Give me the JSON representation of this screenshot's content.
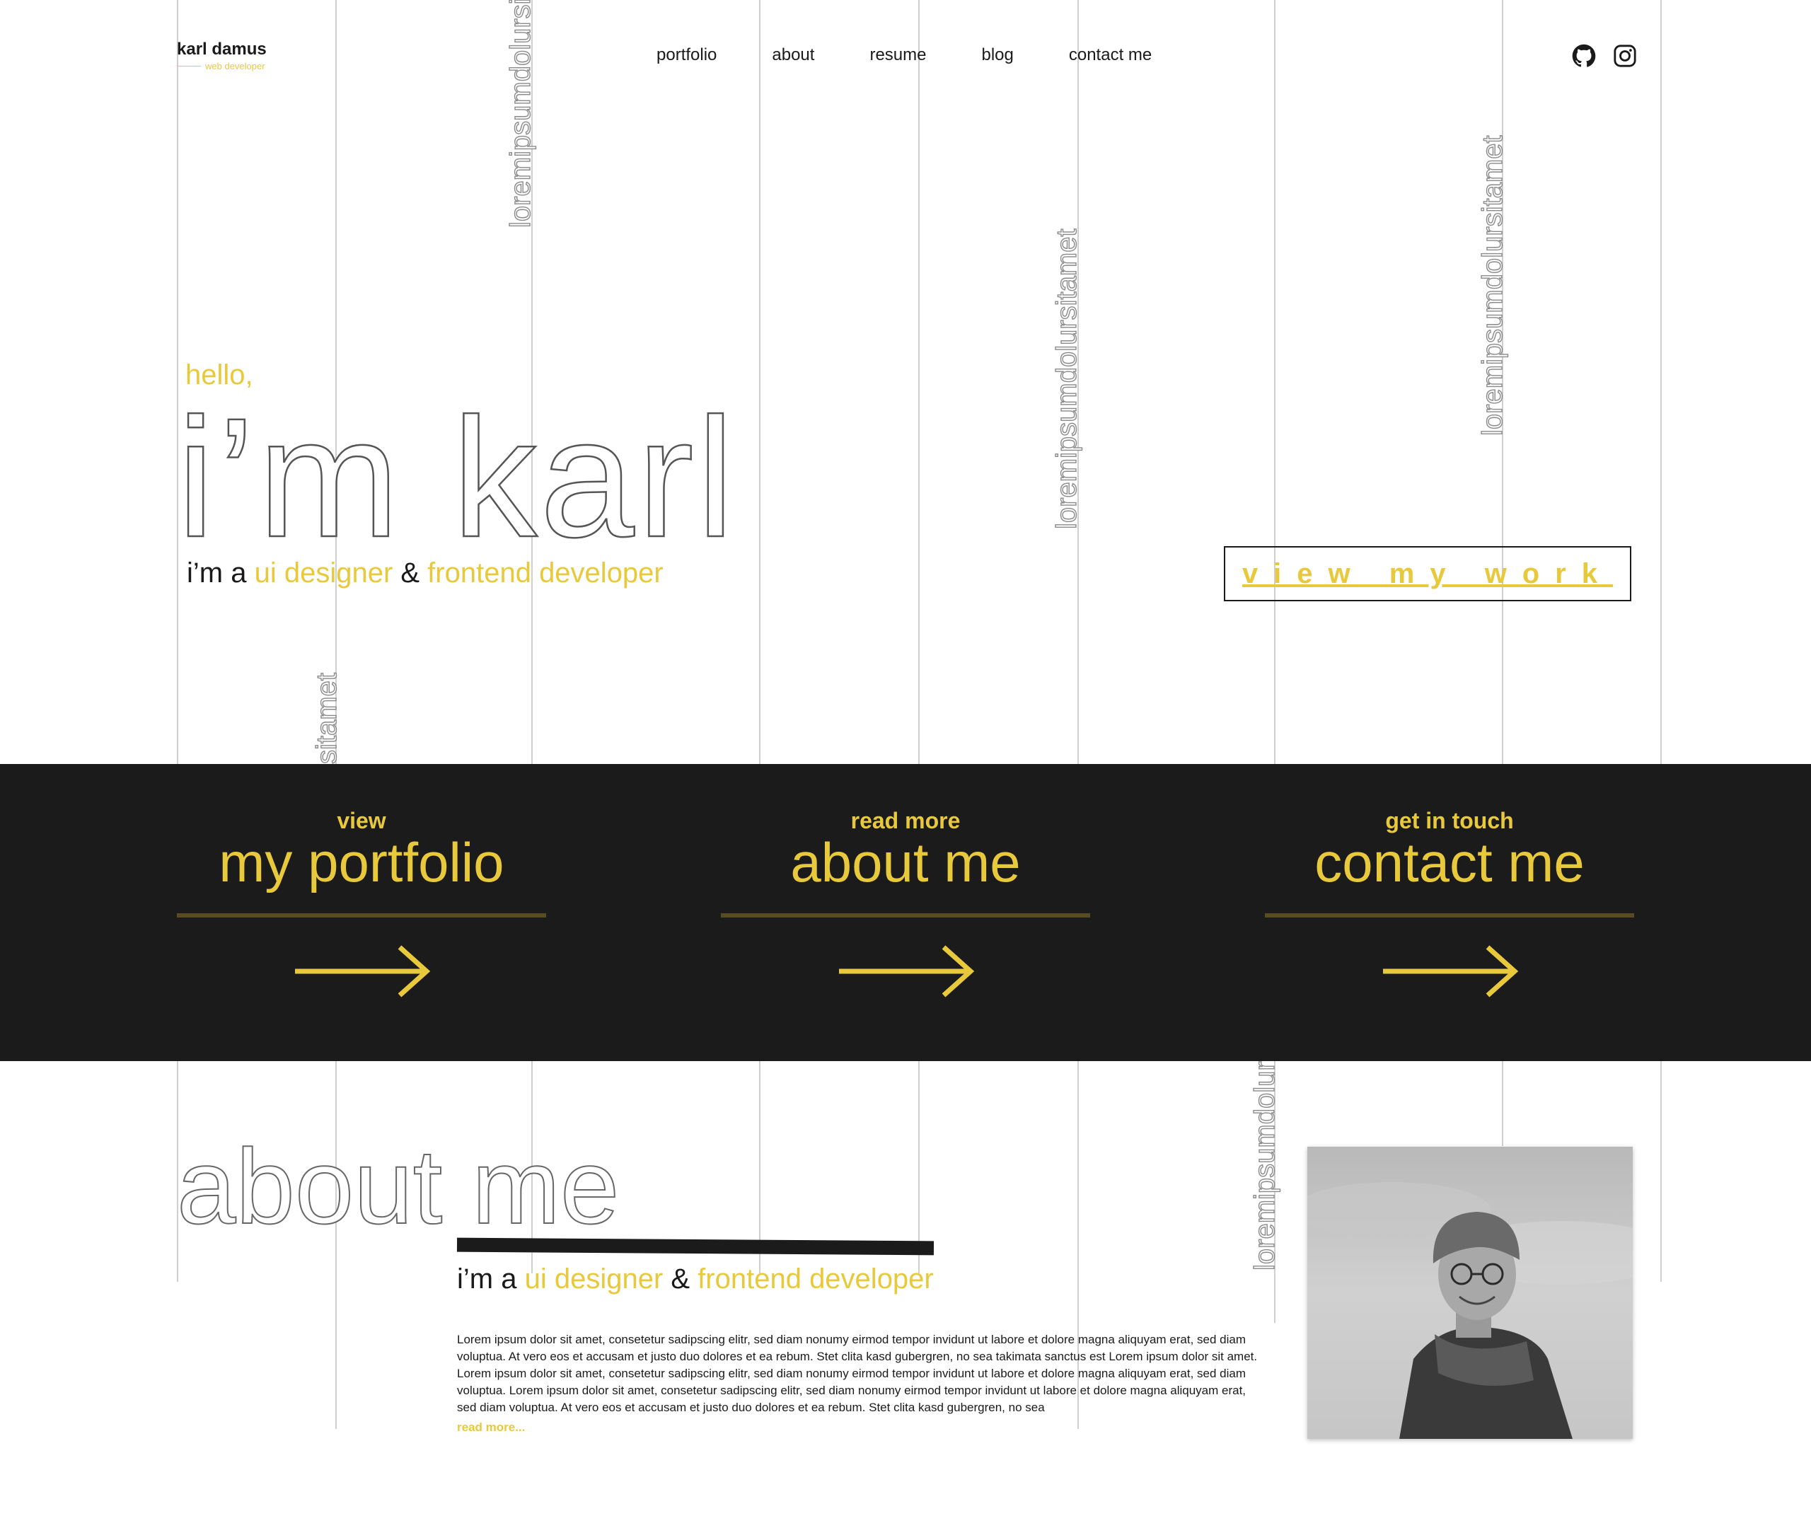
{
  "brand": {
    "name": "karl damus",
    "subtitle": "web developer"
  },
  "nav": [
    "portfolio",
    "about",
    "resume",
    "blog",
    "contact me"
  ],
  "social": [
    "github-icon",
    "instagram-icon"
  ],
  "decor_text": [
    "loremipsumdolursi",
    "loremipsumdolursitamet",
    "loremipsumdolursitamet",
    "sitamet",
    "loremipsumdolur"
  ],
  "hero": {
    "greeting": "hello,",
    "name": "i’m karl",
    "tag_prefix": "i’m a ",
    "tag_role1": "ui designer",
    "tag_and": " & ",
    "tag_role2": "frontend developer",
    "cta": "view my work"
  },
  "cards": [
    {
      "small": "view",
      "large": "my portfolio"
    },
    {
      "small": "read more",
      "large": "about me"
    },
    {
      "small": "get in touch",
      "large": "contact me"
    }
  ],
  "about": {
    "title": "about me",
    "tag_prefix": "i’m a ",
    "tag_role1": "ui designer",
    "tag_and": " & ",
    "tag_role2": "frontend developer",
    "body": "Lorem ipsum dolor sit amet, consetetur sadipscing elitr, sed diam nonumy eirmod tempor invidunt ut labore et dolore magna aliquyam erat, sed diam voluptua. At vero eos et accusam et justo duo dolores et ea rebum. Stet clita kasd gubergren, no sea takimata sanctus est Lorem ipsum dolor sit amet. Lorem ipsum dolor sit amet, consetetur sadipscing elitr, sed diam nonumy eirmod tempor invidunt ut labore et dolore magna aliquyam erat, sed diam voluptua. Lorem ipsum dolor sit amet, consetetur sadipscing elitr, sed diam nonumy eirmod tempor invidunt ut labore et dolore magna aliquyam erat, sed diam voluptua. At vero eos et accusam et justo duo dolores et ea rebum. Stet clita kasd gubergren, no sea",
    "read_more": "read more..."
  },
  "colors": {
    "accent": "#e9c93c",
    "dark": "#1b1b1b",
    "grid": "#cfcfcf"
  }
}
